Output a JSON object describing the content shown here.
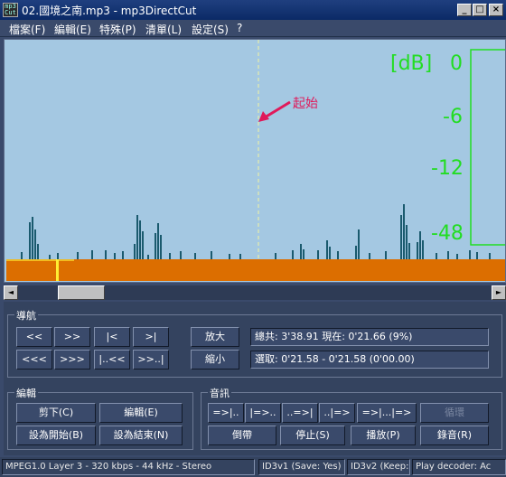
{
  "window": {
    "title": "02.國境之南.mp3 - mp3DirectCut",
    "icon_text": "mp3\nCut",
    "min_glyph": "_",
    "max_glyph": "□",
    "close_glyph": "×"
  },
  "menu": [
    {
      "label": "檔案(F)"
    },
    {
      "label": "編輯(E)"
    },
    {
      "label": "特殊(P)"
    },
    {
      "label": "清單(L)"
    },
    {
      "label": "設定(S)"
    },
    {
      "label": "?"
    }
  ],
  "wave": {
    "db_unit": "[dB]",
    "db_levels": [
      "0",
      "-6",
      "-12",
      "-48"
    ],
    "start_marker_label": "起始",
    "colors": {
      "background": "#a4c8e2",
      "waveform": "#1a5a6e",
      "db_text": "#22dd22",
      "marker": "#e0195a",
      "timeline": "#dc6e00"
    }
  },
  "scrollbar": {
    "left_arrow": "◄",
    "right_arrow": "►"
  },
  "navigation": {
    "label": "導航",
    "row1": [
      "<<",
      ">>",
      "|<",
      ">|"
    ],
    "row2": [
      "<<<",
      ">>>",
      "|..<<",
      ">>..|"
    ],
    "zoom_in": "放大",
    "zoom_out": "縮小",
    "total_position": "總共: 3'38.91  現在: 0'21.66  (9%)",
    "selection": "選取: 0'21.58 - 0'21.58 (0'00.00)"
  },
  "edit": {
    "label": "編輯",
    "cut": "剪下(C)",
    "edit": "編輯(E)",
    "set_begin": "設為開始(B)",
    "set_end": "設為結束(N)"
  },
  "audio": {
    "label": "音訊",
    "row1": [
      "=>|..",
      "|=>..",
      "..=>|",
      "..|=>",
      "=>|...|=>",
      "循環"
    ],
    "rewind": "倒帶",
    "stop": "停止(S)",
    "play": "播放(P)",
    "record": "錄音(R)"
  },
  "status": {
    "format": "MPEG1.0 Layer 3 - 320 kbps - 44 kHz - Stereo",
    "id3v1": "ID3v1 (Save: Yes)",
    "id3v2": "ID3v2 (Keep:",
    "decoder": "Play decoder: Ac"
  }
}
